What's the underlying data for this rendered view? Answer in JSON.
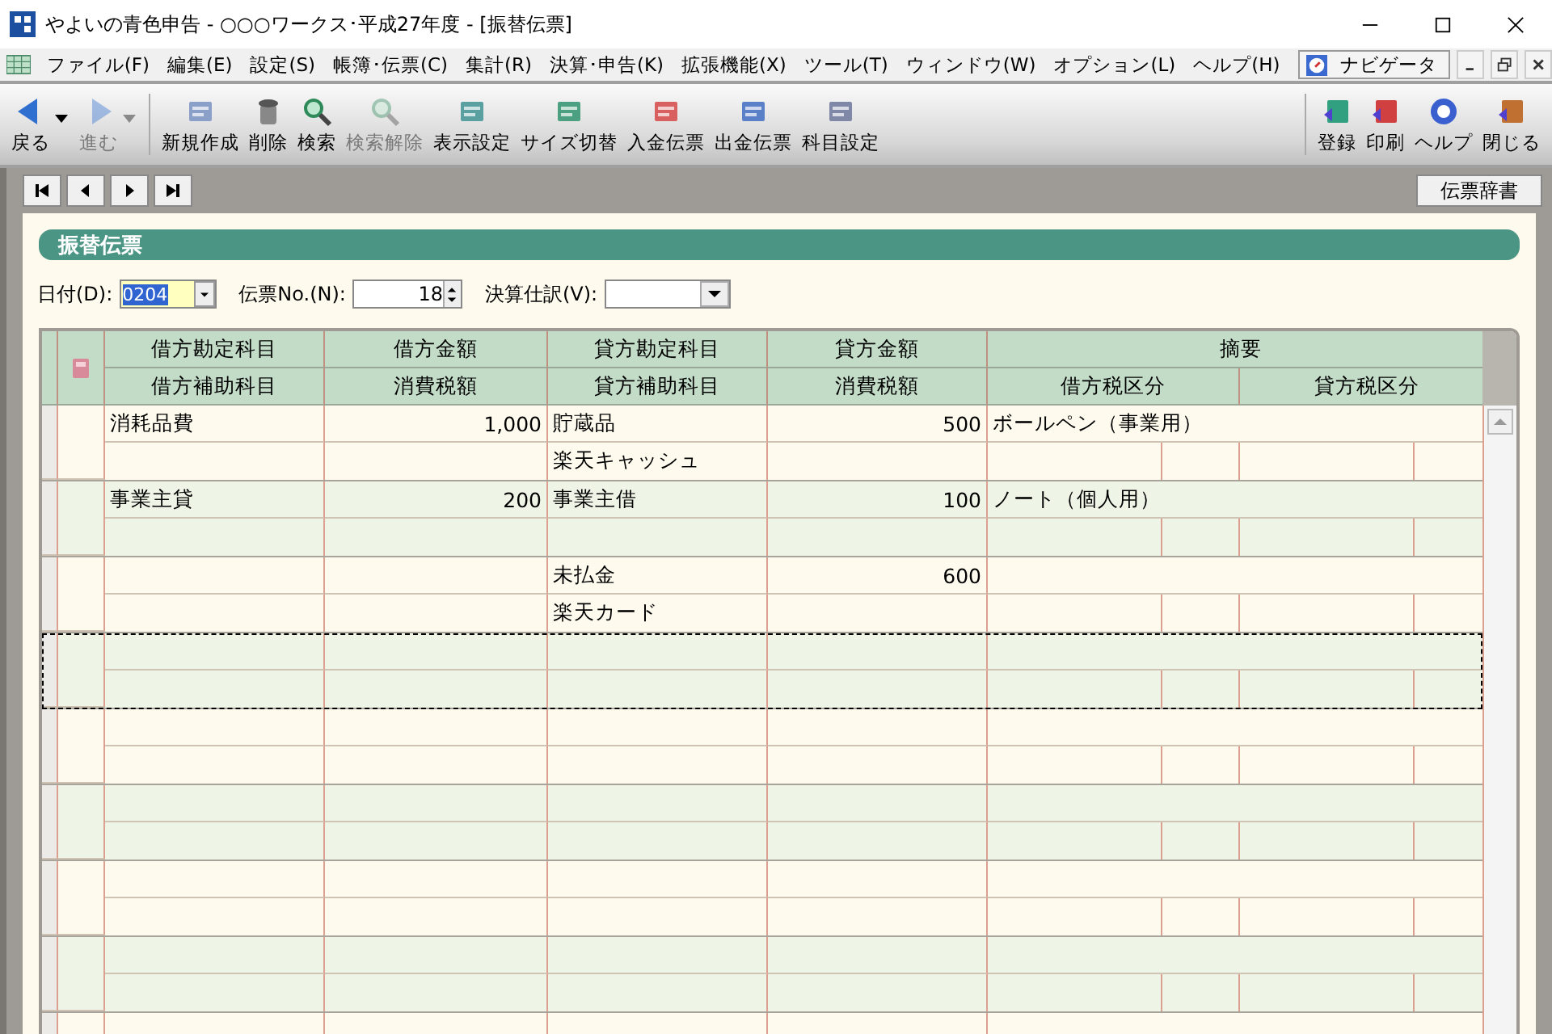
{
  "window": {
    "title": "やよいの青色申告 - ○○○ワークス･平成27年度 - [振替伝票]"
  },
  "menu": [
    "ファイル(F)",
    "編集(E)",
    "設定(S)",
    "帳簿･伝票(C)",
    "集計(R)",
    "決算･申告(K)",
    "拡張機能(X)",
    "ツール(T)",
    "ウィンドウ(W)",
    "オプション(L)",
    "ヘルプ(H)"
  ],
  "navigator": {
    "label": "ナビゲータ"
  },
  "toolbar": [
    {
      "label": "戻る",
      "disabled": false,
      "dropdown": true
    },
    {
      "label": "進む",
      "disabled": true,
      "dropdown": true
    },
    {
      "label": "新規作成",
      "disabled": false
    },
    {
      "label": "削除",
      "disabled": false
    },
    {
      "label": "検索",
      "disabled": false
    },
    {
      "label": "検索解除",
      "disabled": true
    },
    {
      "label": "表示設定",
      "disabled": false
    },
    {
      "label": "サイズ切替",
      "disabled": false
    },
    {
      "label": "入金伝票",
      "disabled": false
    },
    {
      "label": "出金伝票",
      "disabled": false
    },
    {
      "label": "科目設定",
      "disabled": false
    }
  ],
  "toolbar_right": [
    {
      "label": "登録"
    },
    {
      "label": "印刷"
    },
    {
      "label": "ヘルプ"
    },
    {
      "label": "閉じる"
    }
  ],
  "dictionary_button": "伝票辞書",
  "panel_title": "振替伝票",
  "fields": {
    "date_label": "日付(D):",
    "date_value": "0204",
    "number_label": "伝票No.(N):",
    "number_value": "18",
    "closing_label": "決算仕訳(V):"
  },
  "table": {
    "header_top": [
      "借方勘定科目",
      "借方金額",
      "貸方勘定科目",
      "貸方金額",
      "摘要"
    ],
    "header_bottom": [
      "借方補助科目",
      "消費税額",
      "貸方補助科目",
      "消費税額",
      "借方税区分",
      "貸方税区分"
    ]
  },
  "entries": [
    {
      "debit_account": "消耗品費",
      "debit_amount": "1,000",
      "credit_account": "貯蔵品",
      "credit_amount": "500",
      "memo": "ボールペン（事業用）",
      "credit_sub": "楽天キャッシュ",
      "selected": false
    },
    {
      "debit_account": "事業主貸",
      "debit_amount": "200",
      "credit_account": "事業主借",
      "credit_amount": "100",
      "memo": "ノート（個人用）",
      "selected": false
    },
    {
      "credit_account": "未払金",
      "credit_amount": "600",
      "credit_sub": "楽天カード",
      "selected": false
    },
    {
      "selected": true
    },
    {
      "selected": false
    },
    {
      "selected": false
    },
    {
      "selected": false
    },
    {
      "selected": false
    },
    {
      "selected": false
    }
  ]
}
